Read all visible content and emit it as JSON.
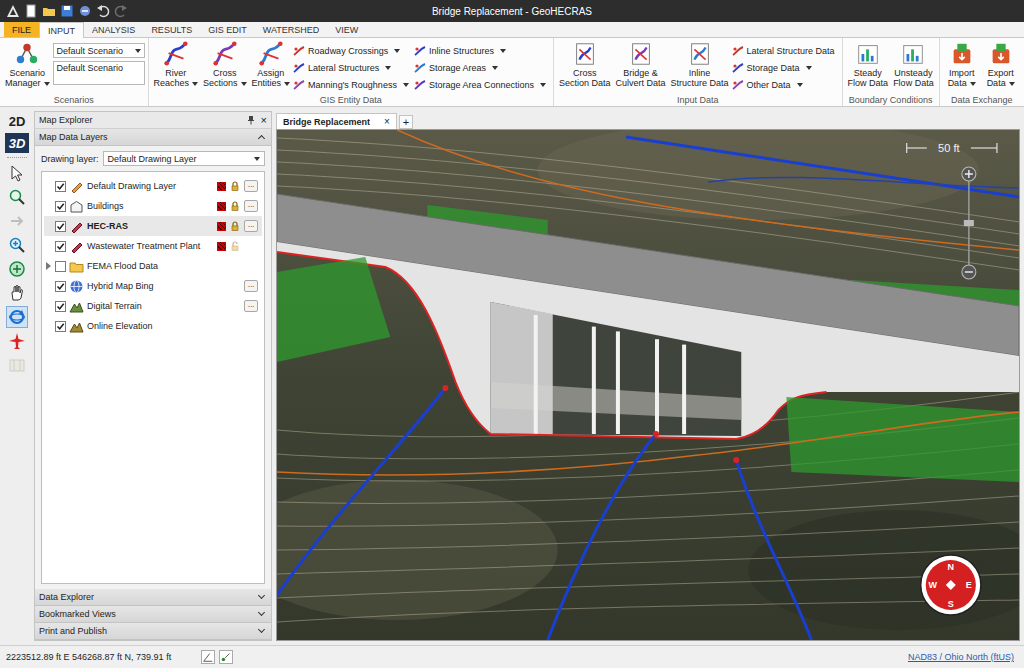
{
  "window": {
    "title": "Bridge Replacement - GeoHECRAS"
  },
  "ribbon_tabs": [
    {
      "label": "FILE",
      "selected": false,
      "kind": "file"
    },
    {
      "label": "INPUT",
      "selected": true,
      "kind": "tab"
    },
    {
      "label": "ANALYSIS",
      "selected": false,
      "kind": "tab"
    },
    {
      "label": "RESULTS",
      "selected": false,
      "kind": "tab"
    },
    {
      "label": "GIS EDIT",
      "selected": false,
      "kind": "tab"
    },
    {
      "label": "WATERSHED",
      "selected": false,
      "kind": "tab"
    },
    {
      "label": "VIEW",
      "selected": false,
      "kind": "tab"
    }
  ],
  "ribbon_groups": [
    {
      "label": "Scenarios",
      "large": [
        {
          "lines": [
            "Scenario",
            "Manager"
          ],
          "dropdown": true
        }
      ],
      "fields": [
        {
          "kind": "select",
          "value": "Default Scenario"
        },
        {
          "kind": "text",
          "value": "Default Scenario"
        }
      ],
      "small_columns": []
    },
    {
      "label": "GIS Entity Data",
      "large": [
        {
          "lines": [
            "River",
            "Reaches"
          ],
          "dropdown": true
        },
        {
          "lines": [
            "Cross",
            "Sections"
          ],
          "dropdown": true
        },
        {
          "lines": [
            "Assign",
            "Entities"
          ],
          "dropdown": true
        }
      ],
      "fields": [],
      "small_columns": [
        [
          {
            "label": "Roadway Crossings",
            "dropdown": true
          },
          {
            "label": "Lateral Structures",
            "dropdown": true
          },
          {
            "label": "Manning's Roughness",
            "dropdown": true
          }
        ],
        [
          {
            "label": "Inline Structures",
            "dropdown": true
          },
          {
            "label": "Storage Areas",
            "dropdown": true
          },
          {
            "label": "Storage Area Connections",
            "dropdown": true
          }
        ]
      ]
    },
    {
      "label": "Input Data",
      "large": [
        {
          "lines": [
            "Cross",
            "Section Data"
          ],
          "dropdown": false
        },
        {
          "lines": [
            "Bridge &",
            "Culvert Data"
          ],
          "dropdown": false
        },
        {
          "lines": [
            "Inline",
            "Structure Data"
          ],
          "dropdown": false
        }
      ],
      "fields": [],
      "small_columns": [
        [
          {
            "label": "Lateral Structure Data",
            "dropdown": false
          },
          {
            "label": "Storage Data",
            "dropdown": true
          },
          {
            "label": "Other Data",
            "dropdown": true
          }
        ]
      ]
    },
    {
      "label": "Boundary Conditions",
      "large": [
        {
          "lines": [
            "Steady",
            "Flow Data"
          ],
          "dropdown": false
        },
        {
          "lines": [
            "Unsteady",
            "Flow Data"
          ],
          "dropdown": false
        }
      ],
      "fields": [],
      "small_columns": []
    },
    {
      "label": "Data Exchange",
      "large": [
        {
          "lines": [
            "Import",
            "Data"
          ],
          "dropdown": true
        },
        {
          "lines": [
            "Export",
            "Data"
          ],
          "dropdown": true
        }
      ],
      "fields": [],
      "small_columns": []
    }
  ],
  "view_modes": [
    {
      "label": "2D",
      "selected": false
    },
    {
      "label": "3D",
      "selected": true
    }
  ],
  "tools": [
    {
      "selected": false,
      "disabled": false
    },
    {
      "selected": false,
      "disabled": false
    },
    {
      "selected": false,
      "disabled": true
    },
    {
      "selected": false,
      "disabled": false
    },
    {
      "selected": false,
      "disabled": false
    },
    {
      "selected": false,
      "disabled": false
    },
    {
      "selected": true,
      "disabled": false
    },
    {
      "selected": false,
      "disabled": false
    },
    {
      "selected": false,
      "disabled": true
    }
  ],
  "explorer": {
    "title": "Map Explorer",
    "close": "×",
    "sections": [
      {
        "label": "Map Data Layers",
        "expanded": true
      },
      {
        "label": "Data Explorer",
        "expanded": false
      },
      {
        "label": "Bookmarked Views",
        "expanded": false
      },
      {
        "label": "Print and Publish",
        "expanded": false
      }
    ],
    "drawing_layer": {
      "label": "Drawing layer:",
      "value": "Default Drawing Layer"
    },
    "more_button": "...",
    "layers": [
      {
        "label": "Default Drawing Layer",
        "checked": true,
        "selected": false,
        "expandable": false,
        "expanded": false,
        "has_style": true,
        "has_lock": true,
        "locked": true,
        "has_more": true
      },
      {
        "label": "Buildings",
        "checked": true,
        "selected": false,
        "expandable": false,
        "expanded": false,
        "has_style": true,
        "has_lock": true,
        "locked": true,
        "has_more": true
      },
      {
        "label": "HEC-RAS",
        "checked": true,
        "selected": true,
        "expandable": false,
        "expanded": false,
        "has_style": true,
        "has_lock": true,
        "locked": true,
        "has_more": true
      },
      {
        "label": "Wastewater Treatment Plant",
        "checked": true,
        "selected": false,
        "expandable": false,
        "expanded": false,
        "has_style": true,
        "has_lock": true,
        "locked": false,
        "has_more": false
      },
      {
        "label": "FEMA Flood Data",
        "checked": false,
        "selected": false,
        "expandable": true,
        "expanded": false,
        "has_style": false,
        "has_lock": false,
        "locked": false,
        "has_more": false
      },
      {
        "label": "Hybrid Map Bing",
        "checked": true,
        "selected": false,
        "expandable": false,
        "expanded": false,
        "has_style": false,
        "has_lock": false,
        "locked": false,
        "has_more": true
      },
      {
        "label": "Digital Terrain",
        "checked": true,
        "selected": false,
        "expandable": false,
        "expanded": false,
        "has_style": false,
        "has_lock": false,
        "locked": false,
        "has_more": true
      },
      {
        "label": "Online Elevation",
        "checked": true,
        "selected": false,
        "expandable": false,
        "expanded": false,
        "has_style": false,
        "has_lock": false,
        "locked": false,
        "has_more": false
      }
    ]
  },
  "map_tabs": [
    {
      "label": "Bridge Replacement",
      "selected": true,
      "close": "×"
    }
  ],
  "new_tab": "+",
  "map": {
    "scale_bar": "50 ft",
    "compass": [
      "N",
      "E",
      "S",
      "W"
    ]
  },
  "status_bar": {
    "coordinates": "2223512.89 ft E 546268.87 ft N, 739.91 ft",
    "crs": "NAD83 / Ohio North (ftUS)"
  }
}
